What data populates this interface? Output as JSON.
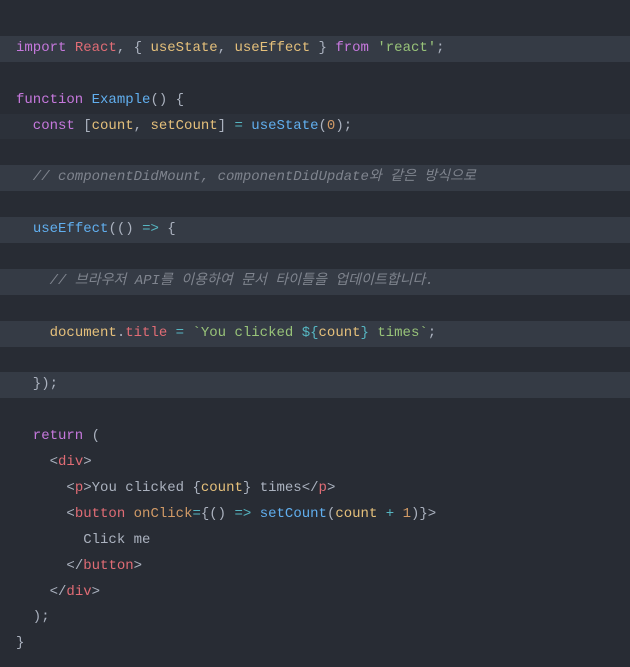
{
  "code": {
    "l1": {
      "import": "import",
      "react": "React",
      "comma": ", ",
      "lb": "{ ",
      "useState": "useState",
      "sep": ", ",
      "useEffect": "useEffect",
      "rb": " }",
      "from": " from ",
      "pkg": "'react'",
      "semi": ";"
    },
    "l3": {
      "fn": "function",
      "name": " Example",
      "paren": "() ",
      "brace": "{"
    },
    "l4": {
      "const": "  const",
      "lb": " [",
      "count": "count",
      "sep": ", ",
      "setCount": "setCount",
      "rb": "] ",
      "eq": "= ",
      "useState": "useState",
      "open": "(",
      "zero": "0",
      "close": ")",
      "semi": ";"
    },
    "l6": {
      "comment": "  // componentDidMount, componentDidUpdate와 같은 방식으로"
    },
    "l7": {
      "indent": "  ",
      "useEffect": "useEffect",
      "open": "(",
      "arrowp": "() ",
      "arrow": "=> ",
      "brace": "{"
    },
    "l8": {
      "comment": "    // 브라우저 API를 이용하여 문서 타이틀을 업데이트합니다."
    },
    "l9": {
      "indent": "    ",
      "doc": "document",
      "dot": ".",
      "title": "title",
      "sp": " ",
      "eq": "= ",
      "bt1": "`",
      "s1": "You clicked ",
      "interp_o": "${",
      "count": "count",
      "interp_c": "}",
      "s2": " times",
      "bt2": "`",
      "semi": ";"
    },
    "l10": {
      "close": "  });"
    },
    "l12": {
      "ret": "  return",
      "paren": " ("
    },
    "l13": {
      "indent": "    ",
      "lt": "<",
      "tag": "div",
      "gt": ">"
    },
    "l14": {
      "indent": "      ",
      "lt": "<",
      "tag": "p",
      "gt": ">",
      "t1": "You clicked ",
      "lb": "{",
      "count": "count",
      "rb": "}",
      "t2": " times",
      "lt2": "</",
      "tag2": "p",
      "gt2": ">"
    },
    "l15": {
      "indent": "      ",
      "lt": "<",
      "tag": "button",
      "sp": " ",
      "attr": "onClick",
      "eq": "=",
      "lb": "{",
      "arrowp": "() ",
      "arrow": "=> ",
      "setCount": "setCount",
      "open": "(",
      "count": "count",
      "plus": " + ",
      "one": "1",
      "close": ")",
      "rb": "}",
      "gt": ">"
    },
    "l16": {
      "text": "        Click me"
    },
    "l17": {
      "indent": "      ",
      "lt": "</",
      "tag": "button",
      "gt": ">"
    },
    "l18": {
      "indent": "    ",
      "lt": "</",
      "tag": "div",
      "gt": ">"
    },
    "l19": {
      "close": "  );"
    },
    "l20": {
      "brace": "}"
    }
  }
}
